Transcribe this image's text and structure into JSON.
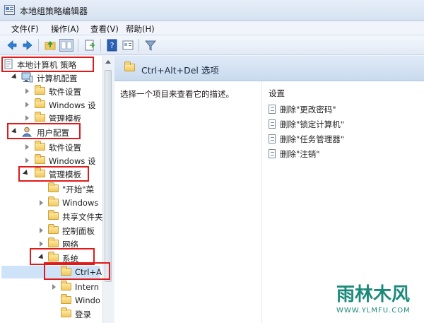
{
  "window": {
    "title": "本地组策略编辑器"
  },
  "menu": [
    "文件(F)",
    "操作(A)",
    "查看(V)",
    "帮助(H)"
  ],
  "toolbar": {
    "icons": [
      "back-icon",
      "forward-icon",
      "up-folder-icon",
      "show-hide-tree-icon",
      "export-list-icon",
      "help-icon",
      "properties-icon",
      "filter-icon"
    ]
  },
  "tree": {
    "root": "本地计算机 策略",
    "computer_config": "计算机配置",
    "cc_software": "软件设置",
    "cc_windows": "Windows 设",
    "cc_admin": "管理模板",
    "user_config": "用户配置",
    "uc_software": "软件设置",
    "uc_windows": "Windows 设",
    "uc_admin": "管理模板",
    "start_menu": "\"开始\"菜",
    "windows_comp": "Windows",
    "shared_folders": "共享文件夹",
    "control_panel": "控制面板",
    "network": "网络",
    "system": "系统",
    "ctrl_alt": "Ctrl+A",
    "internet": "Intern",
    "windo": "Windo",
    "logon": "登录"
  },
  "right_pane": {
    "header": "Ctrl+Alt+Del 选项",
    "description": "选择一个项目来查看它的描述。",
    "settings_header": "设置",
    "settings": [
      "删除\"更改密码\"",
      "删除\"锁定计算机\"",
      "删除\"任务管理器\"",
      "删除\"注销\""
    ]
  },
  "watermark": {
    "main": "雨林木风",
    "url": "WWW.YLMFU.COM"
  },
  "colors": {
    "highlight": "#e01a1a",
    "watermark": "#1c8a7a"
  }
}
